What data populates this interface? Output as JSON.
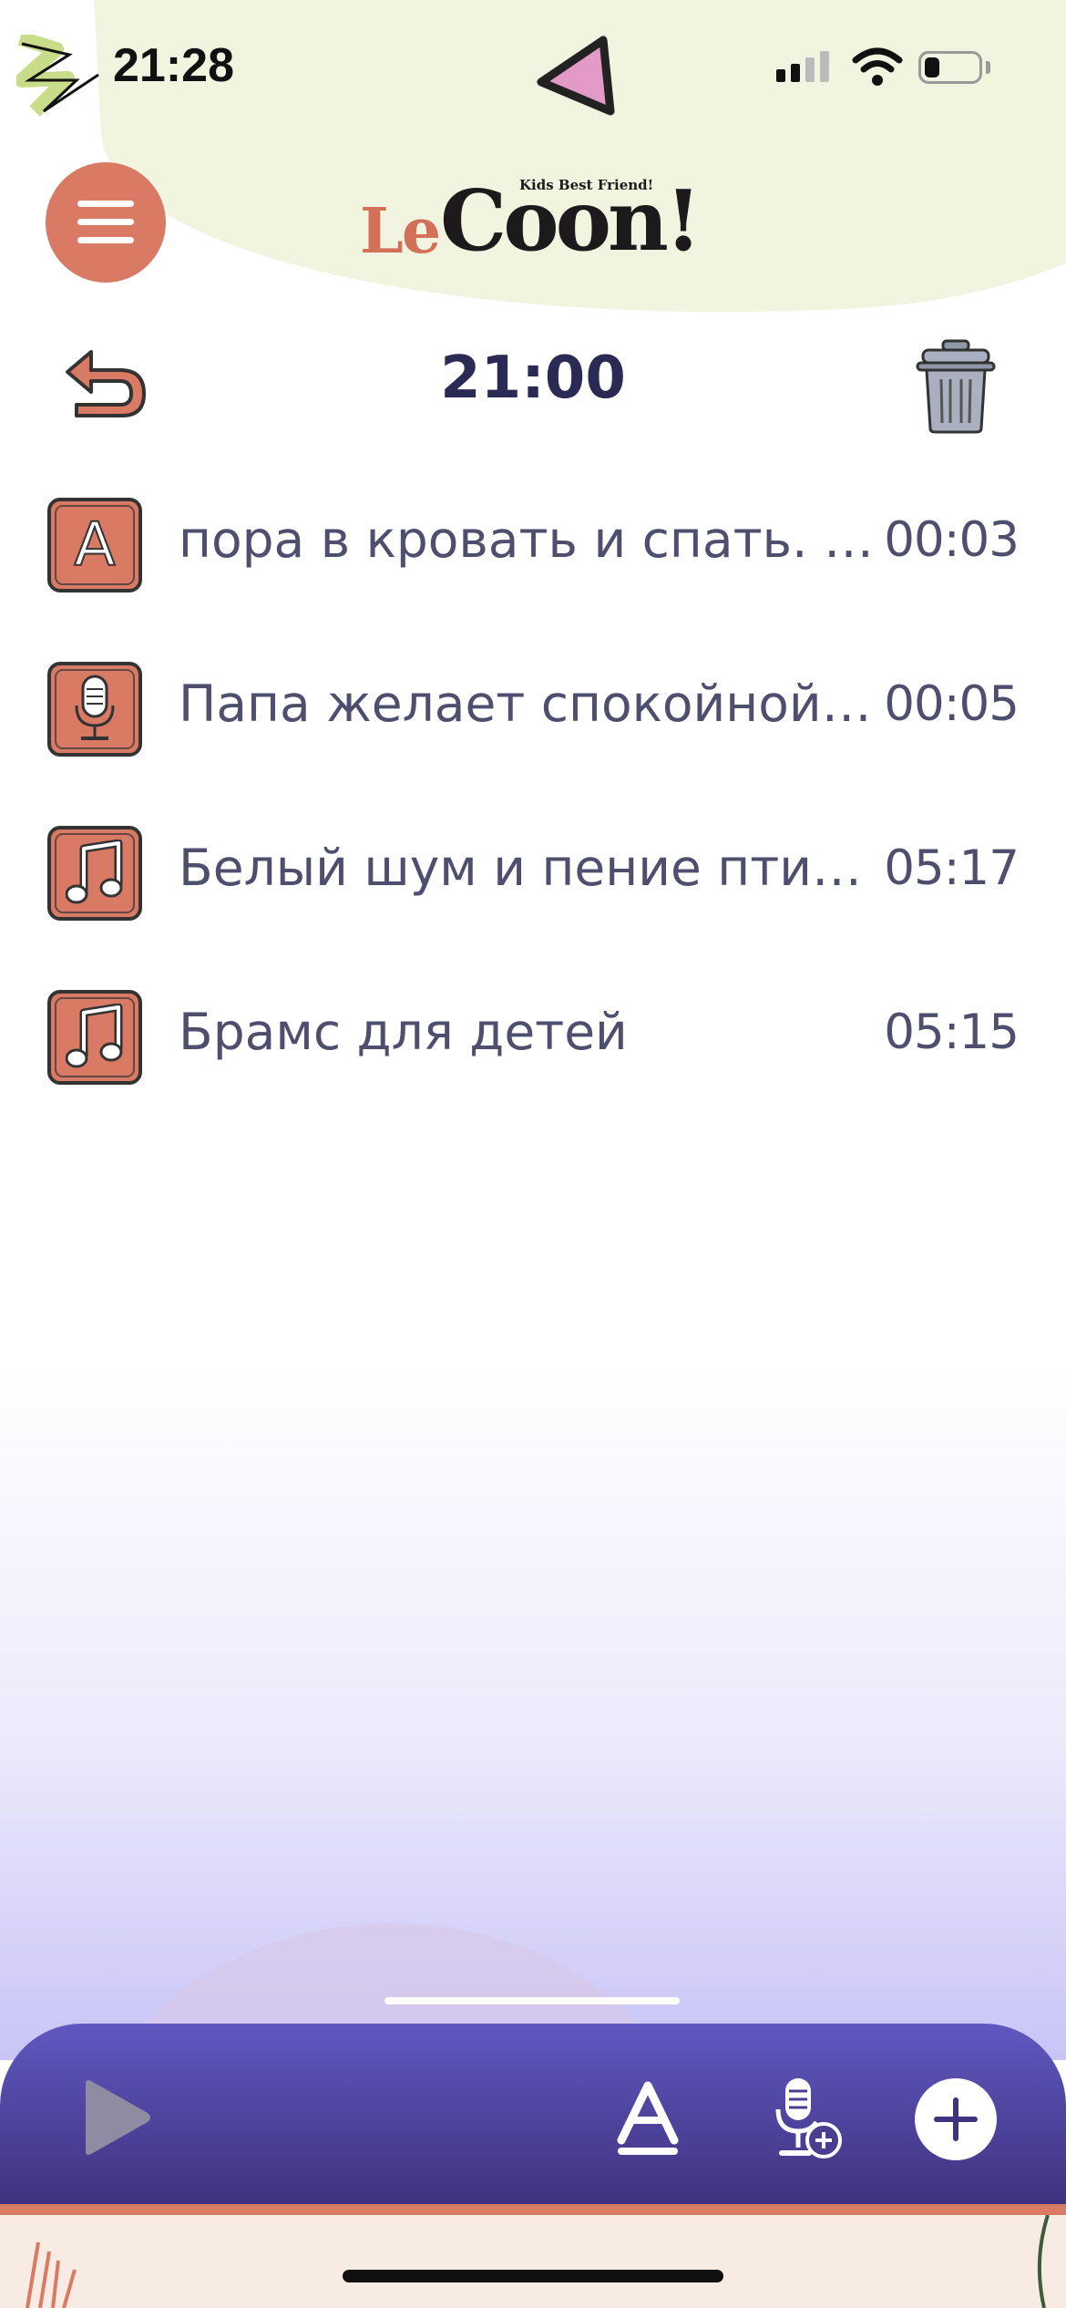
{
  "status_bar": {
    "time": "21:28"
  },
  "header": {
    "logo_le": "Le",
    "logo_coon": "Coon!",
    "logo_tagline": "Kids Best Friend!"
  },
  "toolbar": {
    "alarm_time": "21:00"
  },
  "sounds": [
    {
      "type": "text",
      "icon": "letter-a-icon",
      "glyph": "A",
      "title": "пора в кровать и спать. а теперь спать",
      "duration": "00:03"
    },
    {
      "type": "voice",
      "icon": "microphone-icon",
      "title": "Папа желает спокойной ночи",
      "duration": "00:05"
    },
    {
      "type": "music",
      "icon": "music-note-icon",
      "title": "Белый шум и пение птиц_природа",
      "duration": "05:17"
    },
    {
      "type": "music",
      "icon": "music-note-icon",
      "title": "Брамс для детей",
      "duration": "05:15"
    }
  ],
  "colors": {
    "accent": "#d97a65",
    "text": "#4e4e6e",
    "heading": "#2a2a54",
    "player_bar_top": "#5f58c0",
    "player_bar_bottom": "#3f327e",
    "header_blob": "#f1f4df"
  }
}
